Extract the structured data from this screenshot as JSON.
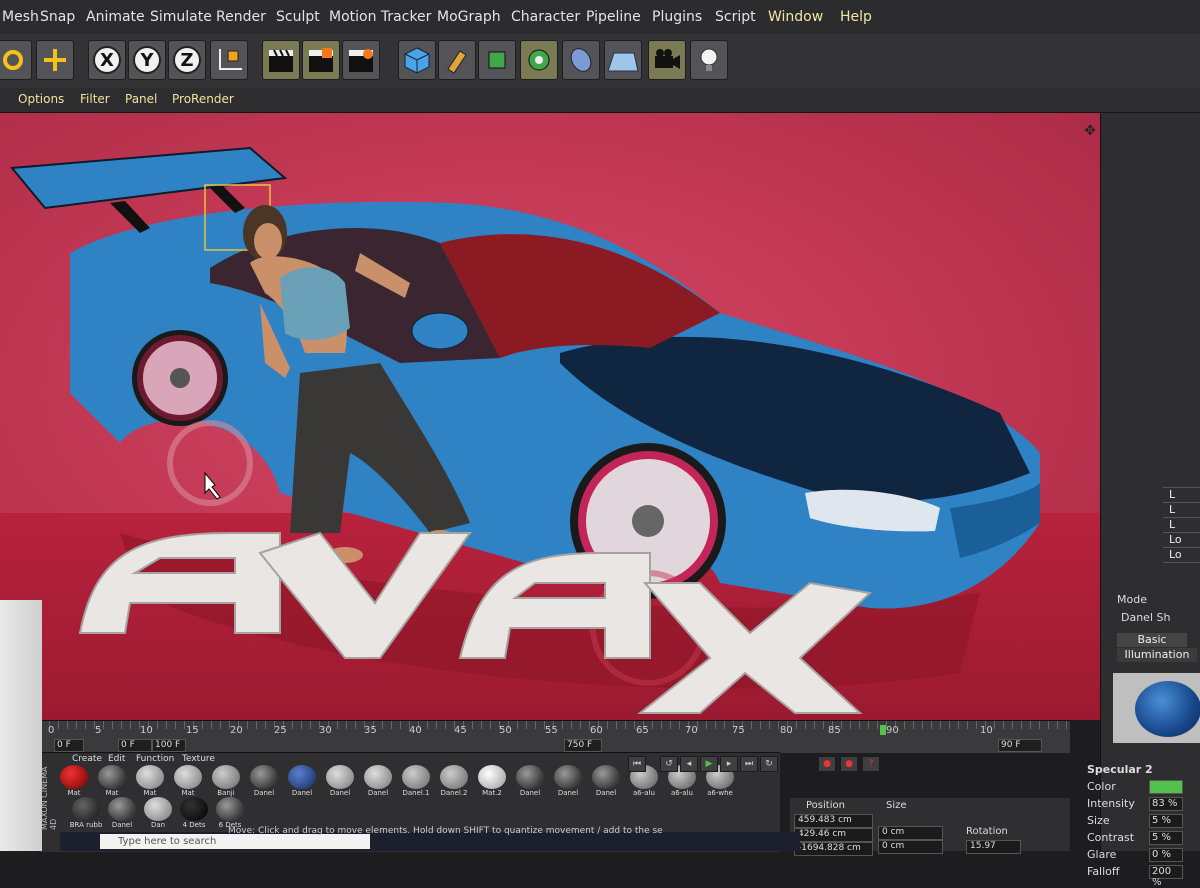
{
  "menu": [
    "Mesh",
    "Snap",
    "Animate",
    "Simulate",
    "Render",
    "Sculpt",
    "Motion Tracker",
    "MoGraph",
    "Character",
    "Pipeline",
    "Plugins",
    "Script",
    "Window",
    "Help"
  ],
  "toolbar": {
    "axes": [
      "X",
      "Y",
      "Z"
    ]
  },
  "submenu": [
    "Options",
    "Filter",
    "Panel",
    "ProRender"
  ],
  "scene": {
    "logo_text": "AVAX"
  },
  "timeline": {
    "ticks": [
      "0",
      "5",
      "10",
      "15",
      "20",
      "25",
      "30",
      "35",
      "40",
      "45",
      "50",
      "55",
      "60",
      "65",
      "70",
      "75",
      "80",
      "85",
      "90"
    ],
    "start_field": "0 F",
    "start_field2": "0 F",
    "end_field": "100 F",
    "end_field2": "750 F",
    "current_frame": "90 F",
    "extra_tick": "10"
  },
  "material_manager": {
    "menu": [
      "Create",
      "Edit",
      "Function",
      "Texture"
    ],
    "row1": [
      "Mat",
      "Mat",
      "Mat",
      "Mat",
      "Banji",
      "Danel",
      "Danel",
      "Danel",
      "Danel",
      "Danel.1",
      "Danel.2",
      "Mat.2",
      "Danel",
      "Danel",
      "Danel",
      "a6-alu",
      "a6-alu",
      "a6-whe"
    ],
    "row2": [
      "BRA rubb",
      "Danel",
      "Dan",
      "4 Dets",
      "6 Dets"
    ]
  },
  "right_panel": {
    "list": [
      "",
      "L",
      "L",
      "L",
      "Lo",
      "Lo"
    ],
    "mode": "Mode",
    "material": "Danel Sh",
    "tab_basic": "Basic",
    "tab_illumination": "Illumination",
    "spec_title": "Specular 2",
    "props": [
      {
        "label": "Color",
        "value": ""
      },
      {
        "label": "Intensity",
        "value": "83 %"
      },
      {
        "label": "Size",
        "value": "5 %"
      },
      {
        "label": "Contrast",
        "value": "5 %"
      },
      {
        "label": "Glare",
        "value": "0 %"
      },
      {
        "label": "Falloff",
        "value": "200 %"
      }
    ]
  },
  "coordinates": {
    "headers": [
      "Position",
      "Size",
      "Rotation"
    ],
    "x": "459.483 cm",
    "y": "429.46 cm",
    "z": "-1694.828 cm",
    "sx": "0 cm",
    "sy": "0 cm",
    "sz": "0 cm",
    "rh": "15.97"
  },
  "status": "Move: Click and drag to move elements. Hold down SHIFT to quantize movement / add to the se",
  "taskbar": {
    "search_placeholder": "Type here to search"
  },
  "side_label": "MAXON CINEMA 4D",
  "colors": {
    "bg_red": "#c43955",
    "car_blue": "#2f82c4",
    "accent_yellow": "#f1e6a6",
    "active_green": "#52c24d"
  }
}
